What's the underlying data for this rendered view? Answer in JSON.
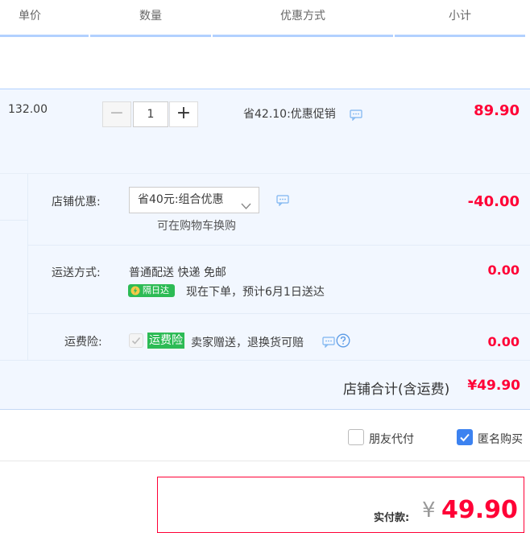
{
  "header": {
    "col_price": "单价",
    "col_qty": "数量",
    "col_discount": "优惠方式",
    "col_subtotal": "小计"
  },
  "item": {
    "unit_price": "132.00",
    "qty_minus": "−",
    "qty_value": "1",
    "qty_plus": "+",
    "discount_text": "省42.10:优惠促销",
    "subtotal": "89.90"
  },
  "shop": {
    "promo_label": "店铺优惠:",
    "promo_selected": "省40元:组合优惠",
    "promo_note": "可在购物车换购",
    "promo_amount": "-40.00",
    "shipping_label": "运送方式:",
    "shipping_method": "普通配送 快递 免邮",
    "next_day_badge": "隔日达",
    "delivery_estimate": "现在下单，预计6月1日送达",
    "shipping_amount": "0.00",
    "insurance_label": "运费险:",
    "insurance_badge": "运费险",
    "insurance_text": "卖家赠送，退换货可赔",
    "insurance_amount": "0.00",
    "shop_total_label": "店铺合计(含运费)",
    "shop_total": "¥49.90"
  },
  "options": {
    "friend_pay": "朋友代付",
    "friend_pay_checked": false,
    "anonymous": "匿名购买",
    "anonymous_checked": true
  },
  "summary": {
    "paid_label": "实付款:",
    "currency": "¥",
    "amount": "49.90"
  },
  "colors": {
    "accent_red": "#ff0036",
    "header_line": "#b2d1ff",
    "band_bg": "#f2f7ff",
    "badge_green": "#2dbb55",
    "checkbox_blue": "#3c82f0"
  }
}
